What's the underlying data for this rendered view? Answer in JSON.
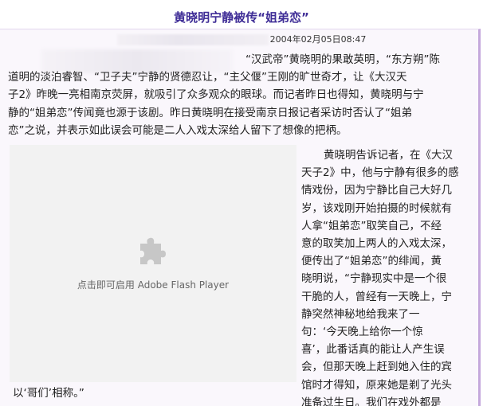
{
  "header": {
    "title": "黄晓明宁静被传“姐弟恋”"
  },
  "meta": {
    "datetime": "2004年02月05日08:47"
  },
  "article": {
    "paragraph1_lines": [
      "“汉武帝”黄晓明的果敢英明，“东方朔”陈",
      "道明的淡泊睿智、“卫子夫”宁静的贤德忍让，“主父偃”王刚的旷世奇才，让《大汉天",
      "子2》昨晚一亮相南京荧屏，就吸引了众多观众的眼球。而记者昨日也得知，黄晓明与宁",
      "静的“姐弟恋”传闻竟也源于该剧。昨日黄晓明在接受南京日报记者采访时否认了“姐弟",
      "恋”之说，并表示如此误会可能是二人入戏太深给人留下了想像的把柄。"
    ],
    "paragraph2_lines": [
      "黄晓明告诉记者，在《大汉",
      "天子2》中，他与宁静有很多的感",
      "情戏份，因为宁静比自己大好几",
      "岁，该戏刚开始拍摄的时候就有",
      "人拿“姐弟恋”取笑自己，不经",
      "意的取笑加上两人的入戏太深，",
      "便传出了“姐弟恋”的绯闻，黄",
      "晓明说，“宁静现实中是一个很",
      "干脆的人，曾经有一天晚上，宁",
      "静突然神秘地给我来了一",
      "句：‘今天晚上给你一个惊",
      "喜’，此番话真的能让人产生误",
      "会，但那天晚上赶到她入住的宾",
      "馆时才得知，原来她是剃了光头",
      "准备过生日。我们在戏外都是"
    ],
    "paragraph3": "以‘哥们’相称。”"
  },
  "flash_placeholder": {
    "label": "点击即可启用 Adobe Flash Player",
    "icon": "puzzle-piece-icon"
  },
  "colors": {
    "title": "#3e2c96",
    "panel_background": "#faf7fc",
    "panel_border": "#c4a8dc",
    "flash_background": "#f2f2f2"
  }
}
